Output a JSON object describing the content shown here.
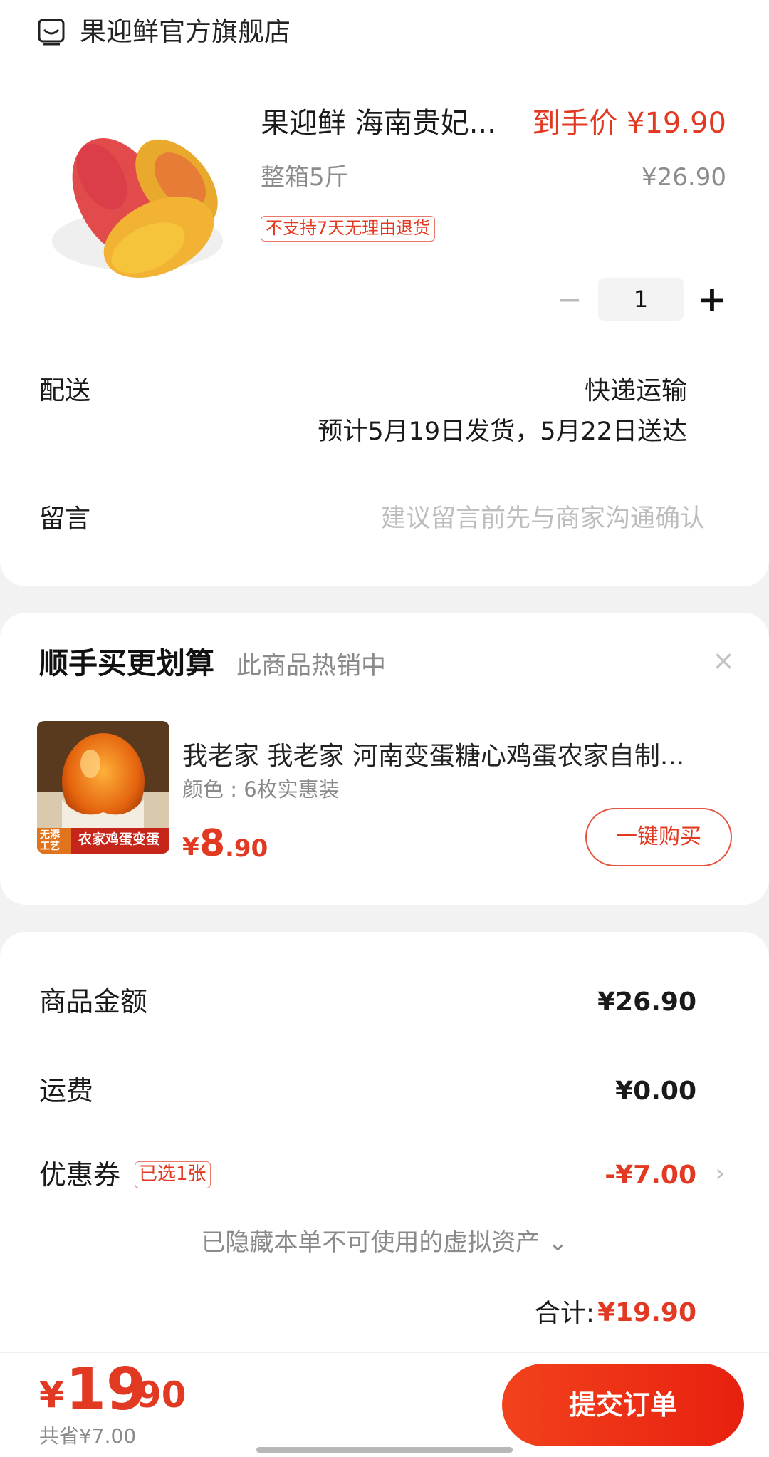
{
  "store": {
    "name": "果迎鲜官方旗舰店",
    "icon": "store-icon"
  },
  "product": {
    "title": "果迎鲜 海南贵妃...",
    "final_price": "到手价 ¥19.90",
    "spec": "整箱5斤",
    "original_price": "¥26.90",
    "return_policy": "不支持7天无理由退货",
    "quantity": "1",
    "minus": "−",
    "plus": "+"
  },
  "delivery": {
    "label": "配送",
    "method": "快递运输",
    "eta": "预计5月19日发货，5月22日送达"
  },
  "message": {
    "label": "留言",
    "placeholder": "建议留言前先与商家沟通确认"
  },
  "upsell": {
    "title": "顺手买更划算",
    "subtitle": "此商品热销中",
    "close": "×",
    "name": "我老家 我老家 河南变蛋糖心鸡蛋农家自制...",
    "variant": "颜色 : 6枚实惠装",
    "image_text": "农家鸡蛋变蛋",
    "image_badge": "无添\n工艺",
    "price_symbol": "¥",
    "price_int": "8",
    "price_dec": ".90",
    "buy_label": "一键购买"
  },
  "summary": {
    "goods_label": "商品金额",
    "goods_value": "¥26.90",
    "shipping_label": "运费",
    "shipping_value": "¥0.00",
    "coupon_label": "优惠券",
    "coupon_badge": "已选1张",
    "coupon_value": "-¥7.00",
    "coupon_chevron": "›",
    "hidden_assets": "已隐藏本单不可使用的虚拟资产 ⌄",
    "total_label": "合计:",
    "total_value": "¥19.90"
  },
  "bottom_bar": {
    "price_symbol": "¥",
    "price_int": "19",
    "price_dec": ".90",
    "saved": "共省¥7.00",
    "submit_label": "提交订单"
  },
  "colors": {
    "accent": "#e23a22",
    "button": "#ef2e17"
  }
}
